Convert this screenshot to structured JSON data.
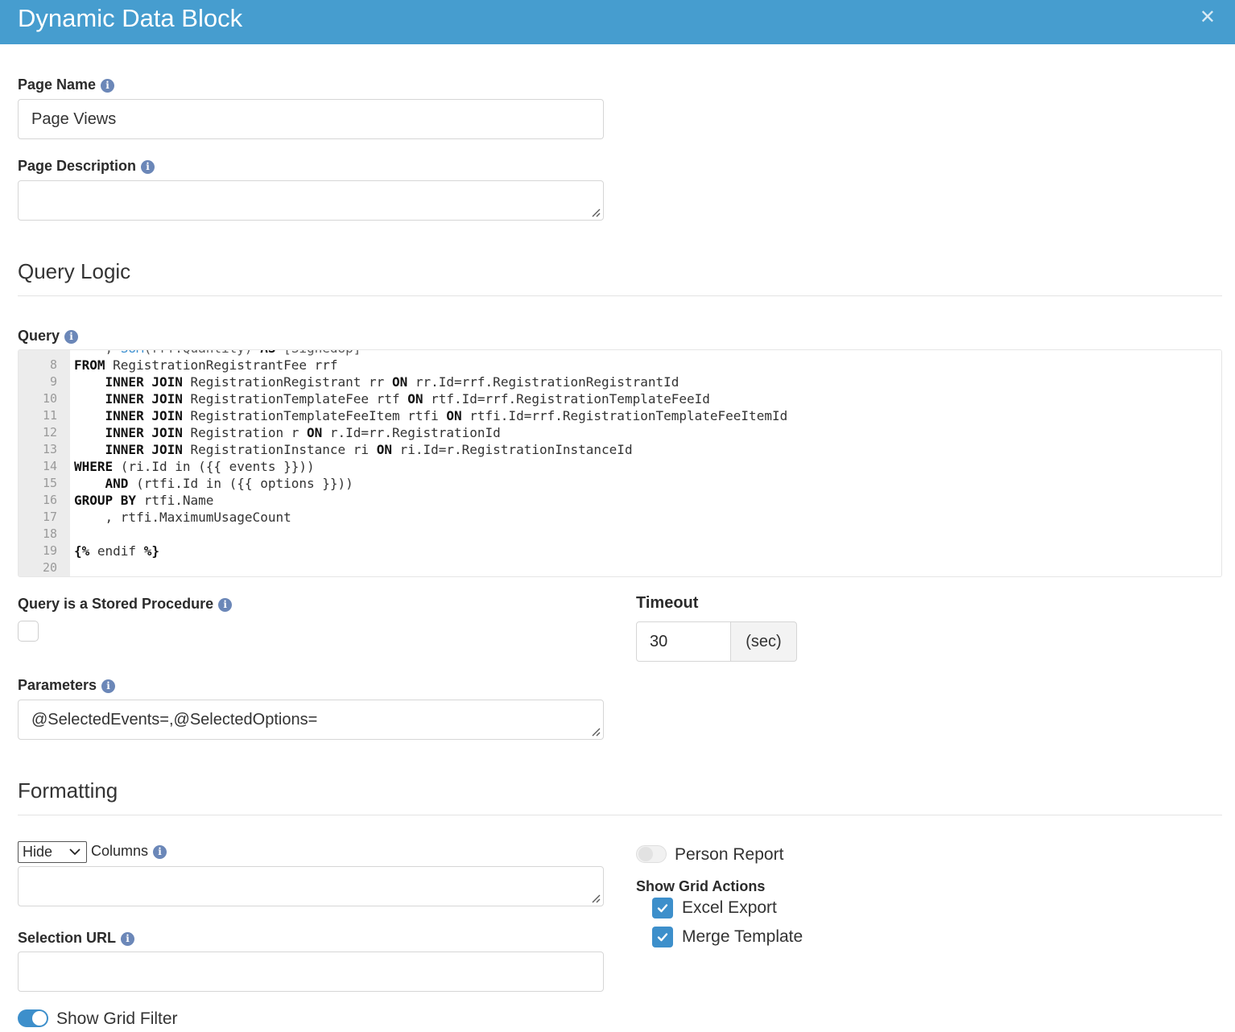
{
  "header": {
    "title": "Dynamic Data Block",
    "close_icon": "close-icon"
  },
  "page_name": {
    "label": "Page Name",
    "value": "Page Views"
  },
  "page_description": {
    "label": "Page Description",
    "value": ""
  },
  "query_logic": {
    "title": "Query Logic"
  },
  "query": {
    "label": "Query",
    "partial_line": "    , SUM(rrf.Quantity) AS [SignedUp]",
    "lines": [
      {
        "n": "8",
        "code": "FROM RegistrationRegistrantFee rrf"
      },
      {
        "n": "9",
        "code": "    INNER JOIN RegistrationRegistrant rr ON rr.Id=rrf.RegistrationRegistrantId"
      },
      {
        "n": "10",
        "code": "    INNER JOIN RegistrationTemplateFee rtf ON rtf.Id=rrf.RegistrationTemplateFeeId"
      },
      {
        "n": "11",
        "code": "    INNER JOIN RegistrationTemplateFeeItem rtfi ON rtfi.Id=rrf.RegistrationTemplateFeeItemId"
      },
      {
        "n": "12",
        "code": "    INNER JOIN Registration r ON r.Id=rr.RegistrationId"
      },
      {
        "n": "13",
        "code": "    INNER JOIN RegistrationInstance ri ON ri.Id=r.RegistrationInstanceId"
      },
      {
        "n": "14",
        "code": "WHERE (ri.Id in ({{ events }}))"
      },
      {
        "n": "15",
        "code": "    AND (rtfi.Id in ({{ options }}))"
      },
      {
        "n": "16",
        "code": "GROUP BY rtfi.Name"
      },
      {
        "n": "17",
        "code": "    , rtfi.MaximumUsageCount"
      },
      {
        "n": "18",
        "code": ""
      },
      {
        "n": "19",
        "code": "{% endif %}"
      },
      {
        "n": "20",
        "code": ""
      }
    ]
  },
  "stored_procedure": {
    "label": "Query is a Stored Procedure",
    "checked": false
  },
  "timeout": {
    "label": "Timeout",
    "value": "30",
    "unit": "(sec)"
  },
  "parameters": {
    "label": "Parameters",
    "value": "@SelectedEvents=,@SelectedOptions="
  },
  "formatting": {
    "title": "Formatting"
  },
  "columns": {
    "select_value": "Hide",
    "label": "Columns",
    "value": ""
  },
  "selection_url": {
    "label": "Selection URL",
    "value": ""
  },
  "show_grid_filter": {
    "label": "Show Grid Filter",
    "on": true
  },
  "person_report": {
    "label": "Person Report",
    "on": false
  },
  "grid_actions": {
    "title": "Show Grid Actions",
    "items": [
      {
        "label": "Excel Export",
        "checked": true
      },
      {
        "label": "Merge Template",
        "checked": true
      }
    ]
  },
  "colors": {
    "header": "#469dcf",
    "accent": "#3d8fcb",
    "info": "#6b87b8"
  }
}
